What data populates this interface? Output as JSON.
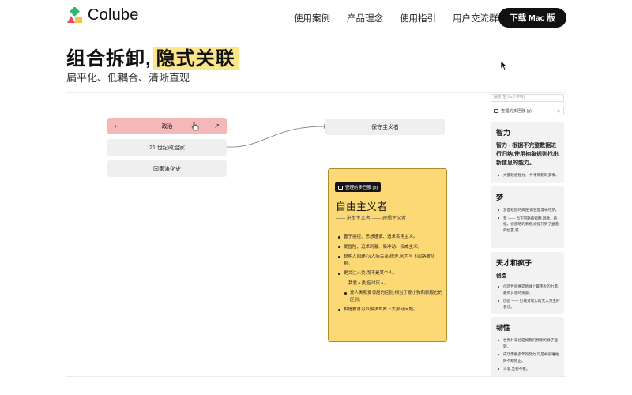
{
  "brand": {
    "name": "Colube"
  },
  "nav": {
    "items": [
      "使用案例",
      "产品理念",
      "使用指引",
      "用户交流群"
    ],
    "download": "下载 Mac 版"
  },
  "hero": {
    "title_part1": "组合拆卸,",
    "title_highlight": "隐式关联",
    "subtitle": "扁平化、低耦合、清晰直观"
  },
  "canvas": {
    "nodes": [
      {
        "label": "政治",
        "selected": true,
        "chevron": "›",
        "arrow": "↗"
      },
      {
        "label": "21 世纪政治家"
      },
      {
        "label": "国家演化史"
      },
      {
        "label": "保守主义者"
      }
    ],
    "card": {
      "tag": "查理的多巴胺 (p)",
      "title": "自由主义者",
      "subtitle": "—— 进步主义者 —— 理想主义者",
      "items": [
        "善于接控、思想谨慎、追求实用主义。",
        "爱冒险、追求刺激、易冲动、权威主义。",
        "聪明人同理心(人际关系)很差,因为当下回路被抑制。",
        "更关注人类,而不是某个人。"
      ],
      "quote": "我爱人类,但讨厌人。",
      "subitem": "爱人类和爱邻居的区别,相当于爱小狗和驯服它的区别。",
      "last_item": "相信教育可以解决世界上大部分问题。"
    }
  },
  "side": {
    "search_placeholder": "搜索(至少2个字符)",
    "selector": "查理的多巴胺 (p)",
    "dropdown_icon": "◇",
    "cards": [
      {
        "title": "智力",
        "big": "智力 - 根据不完整数据进行归纳,使用抽象规则找出新信息的能力。",
        "items": [
          "大量联想智力,一件事情影响多事。"
        ]
      },
      {
        "title": "梦",
        "items": [
          "梦是短暂的疯狂,疯狂是漫长的梦。",
          "梦 —— 当下回路被抑制,唱歌、奇怪、被忽略的事物,被提升到了显著的位置,就"
        ]
      },
      {
        "title": "天才和疯子",
        "subhead": "创造",
        "items": [
          "创造性思维是地球上最伟大的力量,最有价值的资源。",
          "创造 —— 打破对现实的无入为主的看法。"
        ]
      },
      {
        "title": "韧性",
        "items": [
          "世界并非总是如我们预期的样子运转。",
          "成功需要多年的努力,可是却很难始终不断修正。",
          "斗争,坚韧不拔。"
        ]
      }
    ]
  },
  "colors": {
    "accent": "#fde68a",
    "selected_node": "#f4b8b8",
    "card_bg": "#fdd976",
    "button": "#111111"
  },
  "icons": [
    "logo-icon",
    "cursor-icon",
    "hand-cursor-icon",
    "chevron-right-icon",
    "arrow-up-right-icon",
    "card-icon",
    "dropdown-icon"
  ]
}
